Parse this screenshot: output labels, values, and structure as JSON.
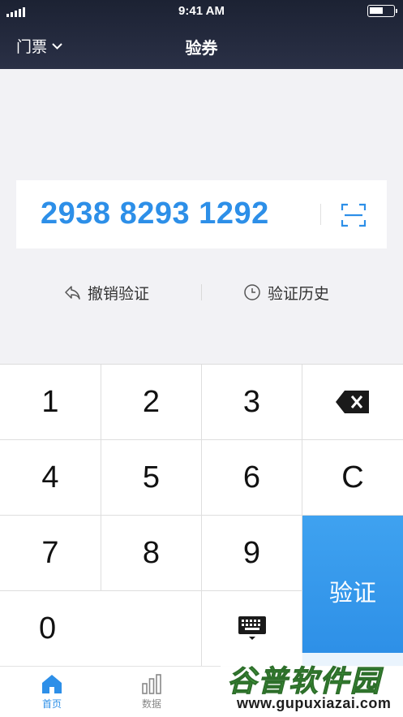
{
  "status_bar": {
    "time": "9:41 AM"
  },
  "nav": {
    "left_label": "门票",
    "title": "验券"
  },
  "voucher": {
    "code": "2938 8293 1292"
  },
  "actions": {
    "undo_label": "撤销验证",
    "history_label": "验证历史"
  },
  "keypad": {
    "keys": [
      "1",
      "2",
      "3",
      "4",
      "5",
      "6",
      "C",
      "7",
      "8",
      "9",
      "0"
    ],
    "verify_label": "验证"
  },
  "tabs": [
    {
      "label": "首页",
      "icon": "home-icon"
    },
    {
      "label": "数据",
      "icon": "bar-chart-icon"
    }
  ],
  "watermark": {
    "title": "谷普软件园",
    "url": "www.gupuxiazai.com"
  },
  "colors": {
    "accent": "#2d8fe8",
    "header": "#1f2538",
    "watermark_green": "#3e9a3a"
  }
}
